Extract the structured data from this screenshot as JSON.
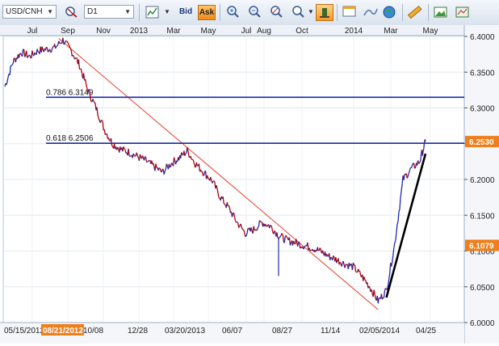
{
  "toolbar": {
    "symbol": "USD/CNH",
    "timeframe": "D1",
    "bid_label": "Bid",
    "ask_label": "Ask",
    "icons": [
      "symbol-search-icon",
      "timeframe-icon",
      "chart-style-icon",
      "bid-toggle",
      "ask-toggle",
      "zoom-in-icon",
      "zoom-out-icon",
      "draw-tool-icon",
      "zoom-range-icon",
      "crosshair-icon",
      "chart-window-icon",
      "indicator-icon",
      "globe-icon",
      "ruler-icon",
      "image-export-icon",
      "print-icon"
    ]
  },
  "top_time_labels": [
    "Jul",
    "Sep",
    "Nov",
    "2013",
    "Mar",
    "May",
    "Jul",
    "Aug",
    "Oct",
    "2014",
    "Mar",
    "May"
  ],
  "bottom_date_labels": [
    "05/15/2012",
    "08/21/2012",
    "10/08",
    "12/28",
    "03/20/2013",
    "06/07",
    "08/27",
    "11/14",
    "02/05/2014",
    "04/25"
  ],
  "price_ticks": [
    "6.4000",
    "6.3500",
    "6.3000",
    "6.2500",
    "6.2000",
    "6.1500",
    "6.1000",
    "6.0500",
    "6.0000"
  ],
  "fib_levels": [
    {
      "label": "0.786 6.3149",
      "value": 6.3149
    },
    {
      "label": "0.618 6.2506",
      "value": 6.2506
    }
  ],
  "current_price_label": "6.2530",
  "secondary_price_label": "6.1079",
  "colors": {
    "fib_line": "#1a2aa8",
    "trend_line": "#e8402a",
    "support_line": "#000000",
    "price_series": "#b40000",
    "up_bar": "#1e2ab0",
    "price_tag_bg": "#f07e1a"
  },
  "chart_data": {
    "type": "line",
    "x": [
      "2012-05-15",
      "2012-05-29",
      "2012-06-12",
      "2012-06-26",
      "2012-07-10",
      "2012-07-24",
      "2012-08-07",
      "2012-08-21",
      "2012-09-04",
      "2012-09-18",
      "2012-10-02",
      "2012-10-16",
      "2012-10-30",
      "2012-11-13",
      "2012-11-27",
      "2012-12-11",
      "2012-12-25",
      "2013-01-08",
      "2013-01-22",
      "2013-02-05",
      "2013-02-19",
      "2013-03-05",
      "2013-03-19",
      "2013-04-02",
      "2013-04-16",
      "2013-04-30",
      "2013-05-14",
      "2013-05-28",
      "2013-06-11",
      "2013-06-25",
      "2013-07-09",
      "2013-07-23",
      "2013-08-06",
      "2013-08-20",
      "2013-09-03",
      "2013-09-17",
      "2013-10-01",
      "2013-10-15",
      "2013-10-29",
      "2013-11-12",
      "2013-11-26",
      "2013-12-10",
      "2013-12-24",
      "2014-01-07",
      "2014-01-21",
      "2014-02-04",
      "2014-02-18",
      "2014-03-04",
      "2014-03-18",
      "2014-04-01",
      "2014-04-15",
      "2014-04-25"
    ],
    "series": [
      {
        "values": [
          6.33,
          6.365,
          6.378,
          6.372,
          6.38,
          6.382,
          6.384,
          6.395,
          6.38,
          6.36,
          6.325,
          6.3,
          6.27,
          6.25,
          6.242,
          6.238,
          6.232,
          6.226,
          6.218,
          6.21,
          6.222,
          6.23,
          6.24,
          6.222,
          6.21,
          6.198,
          6.175,
          6.16,
          6.14,
          6.125,
          6.13,
          6.14,
          6.135,
          6.122,
          6.115,
          6.112,
          6.108,
          6.105,
          6.1,
          6.093,
          6.088,
          6.082,
          6.078,
          6.065,
          6.05,
          6.03,
          6.045,
          6.11,
          6.2,
          6.215,
          6.225,
          6.253
        ]
      }
    ],
    "ylim": [
      6.0,
      6.4
    ],
    "annotations": [
      "0.786 6.3149",
      "0.618 6.2506"
    ],
    "grid": true
  }
}
